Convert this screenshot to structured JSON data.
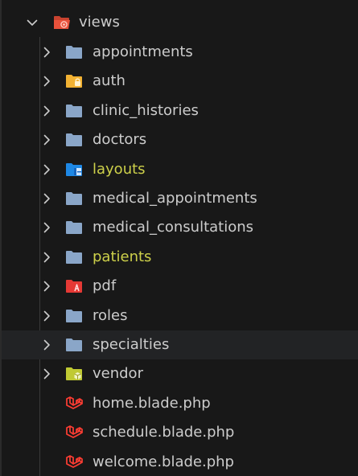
{
  "root": {
    "label": "views",
    "expanded": true,
    "icon": "views-folder-open-icon",
    "color": "#e8513b"
  },
  "items": [
    {
      "label": "appointments",
      "kind": "folder",
      "icon": "folder-icon",
      "color": "#8aa6c8",
      "highlight": false
    },
    {
      "label": "auth",
      "kind": "folder",
      "icon": "folder-lock-icon",
      "color": "#f2b233",
      "highlight": false
    },
    {
      "label": "clinic_histories",
      "kind": "folder",
      "icon": "folder-icon",
      "color": "#8aa6c8",
      "highlight": false
    },
    {
      "label": "doctors",
      "kind": "folder",
      "icon": "folder-icon",
      "color": "#8aa6c8",
      "highlight": false
    },
    {
      "label": "layouts",
      "kind": "folder",
      "icon": "folder-layout-icon",
      "color": "#1e88e5",
      "highlight": true
    },
    {
      "label": "medical_appointments",
      "kind": "folder",
      "icon": "folder-icon",
      "color": "#8aa6c8",
      "highlight": false
    },
    {
      "label": "medical_consultations",
      "kind": "folder",
      "icon": "folder-icon",
      "color": "#8aa6c8",
      "highlight": false
    },
    {
      "label": "patients",
      "kind": "folder",
      "icon": "folder-icon",
      "color": "#8aa6c8",
      "highlight": true
    },
    {
      "label": "pdf",
      "kind": "folder",
      "icon": "folder-pdf-icon",
      "color": "#e53935",
      "highlight": false
    },
    {
      "label": "roles",
      "kind": "folder",
      "icon": "folder-icon",
      "color": "#8aa6c8",
      "highlight": false
    },
    {
      "label": "specialties",
      "kind": "folder",
      "icon": "folder-icon",
      "color": "#8aa6c8",
      "highlight": false,
      "selected": true
    },
    {
      "label": "vendor",
      "kind": "folder",
      "icon": "folder-vendor-icon",
      "color": "#c0ca33",
      "highlight": false
    },
    {
      "label": "home.blade.php",
      "kind": "file",
      "icon": "laravel-blade-icon",
      "color": "#ff3d33",
      "highlight": false
    },
    {
      "label": "schedule.blade.php",
      "kind": "file",
      "icon": "laravel-blade-icon",
      "color": "#ff3d33",
      "highlight": false
    },
    {
      "label": "welcome.blade.php",
      "kind": "file",
      "icon": "laravel-blade-icon",
      "color": "#ff3d33",
      "highlight": false
    }
  ]
}
